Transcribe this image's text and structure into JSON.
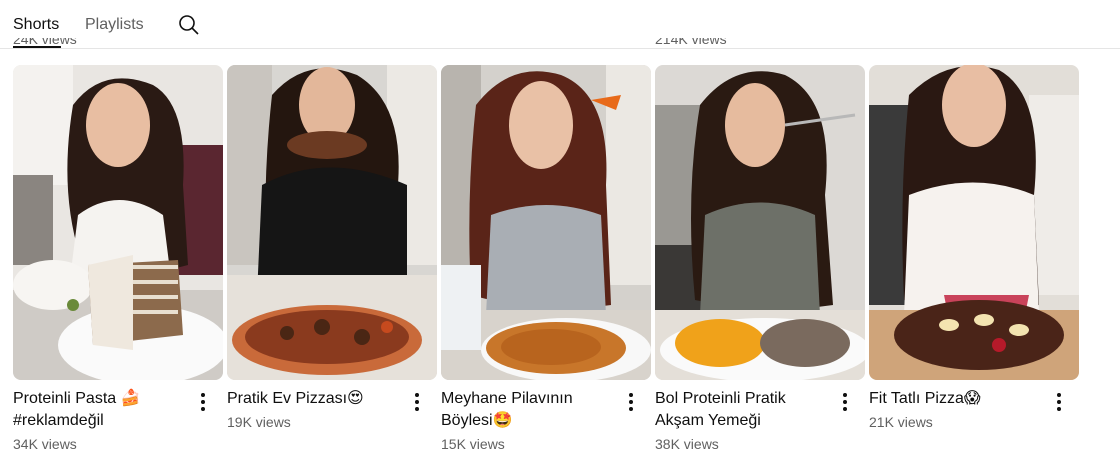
{
  "tabs": [
    {
      "label": "Shorts",
      "active": true
    },
    {
      "label": "Playlists",
      "active": false
    }
  ],
  "icons": {
    "search": "search-icon",
    "menu": "more-vert-icon"
  },
  "previous_row_views": [
    "24K views",
    "214K views"
  ],
  "shorts": [
    {
      "title": "Proteinli Pasta 🍰 #reklamdeğil",
      "views": "34K views"
    },
    {
      "title": "Pratik Ev Pizzası😍",
      "views": "19K views"
    },
    {
      "title": "Meyhane Pilavının Böylesi🤩",
      "views": "15K views"
    },
    {
      "title": "Bol Proteinli Pratik Akşam Yemeği",
      "views": "38K views"
    },
    {
      "title": "Fit Tatlı Pizza😱",
      "views": "21K views"
    }
  ]
}
